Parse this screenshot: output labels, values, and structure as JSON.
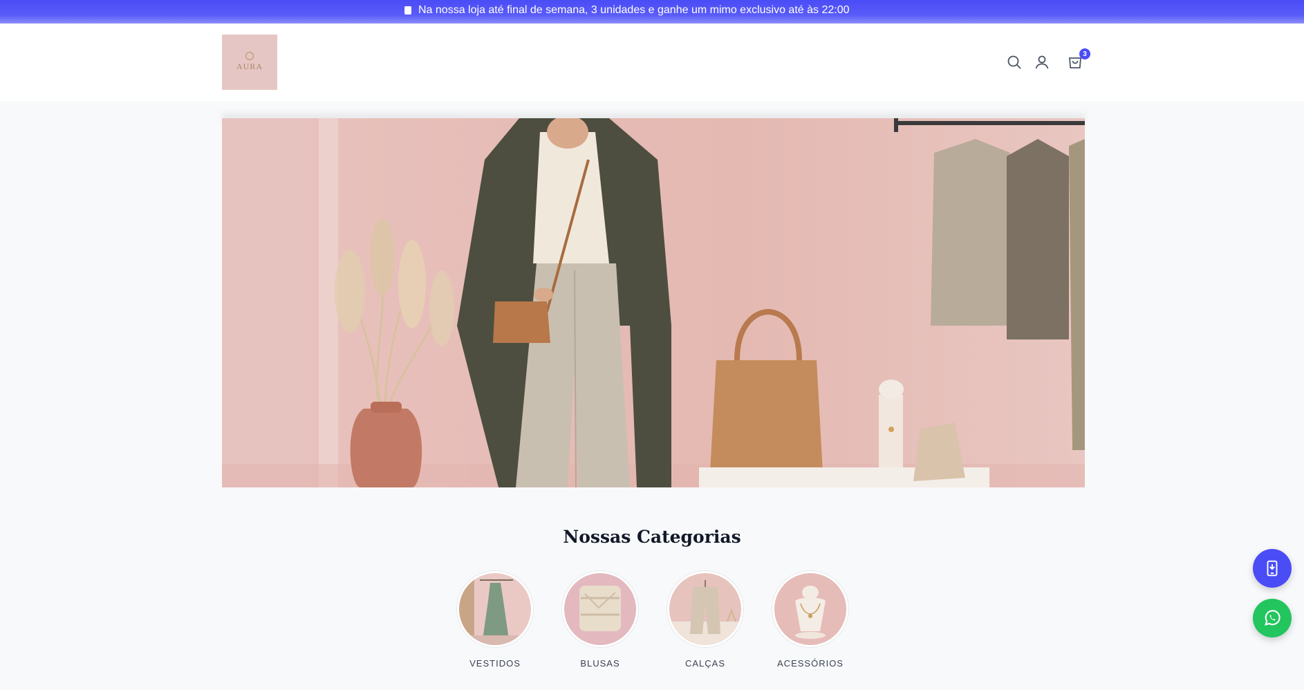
{
  "announcement": {
    "icon": "mobile-phone-icon",
    "text": "Na nossa loja até final de semana, 3 unidades e ganhe um mimo exclusivo até às 22:00"
  },
  "header": {
    "logo": {
      "text": "AURA",
      "subtext": ""
    },
    "icons": [
      "search-icon",
      "user-icon",
      "shopping-bag-icon"
    ],
    "cart_count": "3"
  },
  "categories": {
    "title": "Nossas Categorias",
    "items": [
      {
        "label": "VESTIDOS"
      },
      {
        "label": "BLUSAS"
      },
      {
        "label": "CALÇAS"
      },
      {
        "label": "ACESSÓRIOS"
      }
    ]
  },
  "floating": {
    "app_icon": "mobile-app-icon",
    "whatsapp_icon": "whatsapp-icon"
  },
  "colors": {
    "accent": "#4a4cf6",
    "whatsapp": "#22c55e",
    "background": "#f8f9fb"
  }
}
